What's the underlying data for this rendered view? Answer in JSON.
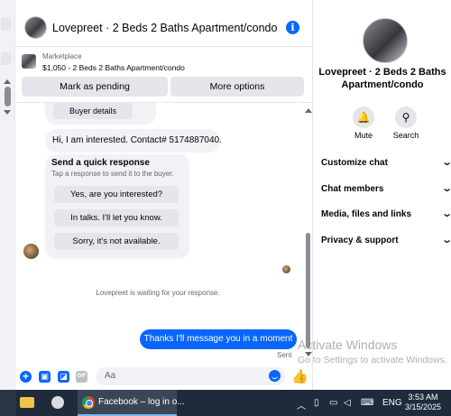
{
  "chat": {
    "title": "Lovepreet · 2 Beds 2 Baths Apartment/condo",
    "info_icon": "i",
    "marketplace_label": "Marketplace",
    "listing": "$1,050 - 2 Beds 2 Baths Apartment/condo",
    "mark_pending_label": "Mark as pending",
    "more_options_label": "More options"
  },
  "messages": {
    "buyer_details": "Buyer details",
    "interested": "Hi, I am interested. Contact# 5174887040.",
    "quick_title": "Send a quick response",
    "quick_subtitle": "Tap a response to send it to the buyer.",
    "quick_replies": [
      "Yes, are you interested?",
      "In talks. I'll let you know.",
      "Sorry, it's not available."
    ],
    "waiting": "Lovepreet is waiting for your response.",
    "outgoing": "Thanks I'll message you in a moment",
    "sent_status": "Sent"
  },
  "composer": {
    "placeholder": "Aa",
    "gif_label": "GIF"
  },
  "side_panel": {
    "name": "Lovepreet · 2 Beds 2 Baths Apartment/condo",
    "mute_label": "Mute",
    "search_label": "Search",
    "sections": [
      "Customize chat",
      "Chat members",
      "Media, files and links",
      "Privacy & support"
    ]
  },
  "watermark": {
    "title": "Activate Windows",
    "subtitle": "Go to Settings to activate Windows."
  },
  "taskbar": {
    "chrome_tab": "Facebook – log in o...",
    "language": "ENG",
    "time": "3:53 AM",
    "date": "3/15/2025"
  },
  "icons": [
    "info-icon",
    "plus-icon",
    "photo-icon",
    "sticker-icon",
    "gif-icon",
    "emoji-icon",
    "like-icon",
    "bell-icon",
    "search-icon",
    "chevron-down-icon"
  ],
  "colors": {
    "accent": "#0866ff",
    "bubble_gray": "#f0f2f5",
    "taskbar": "#1f2b3a"
  }
}
